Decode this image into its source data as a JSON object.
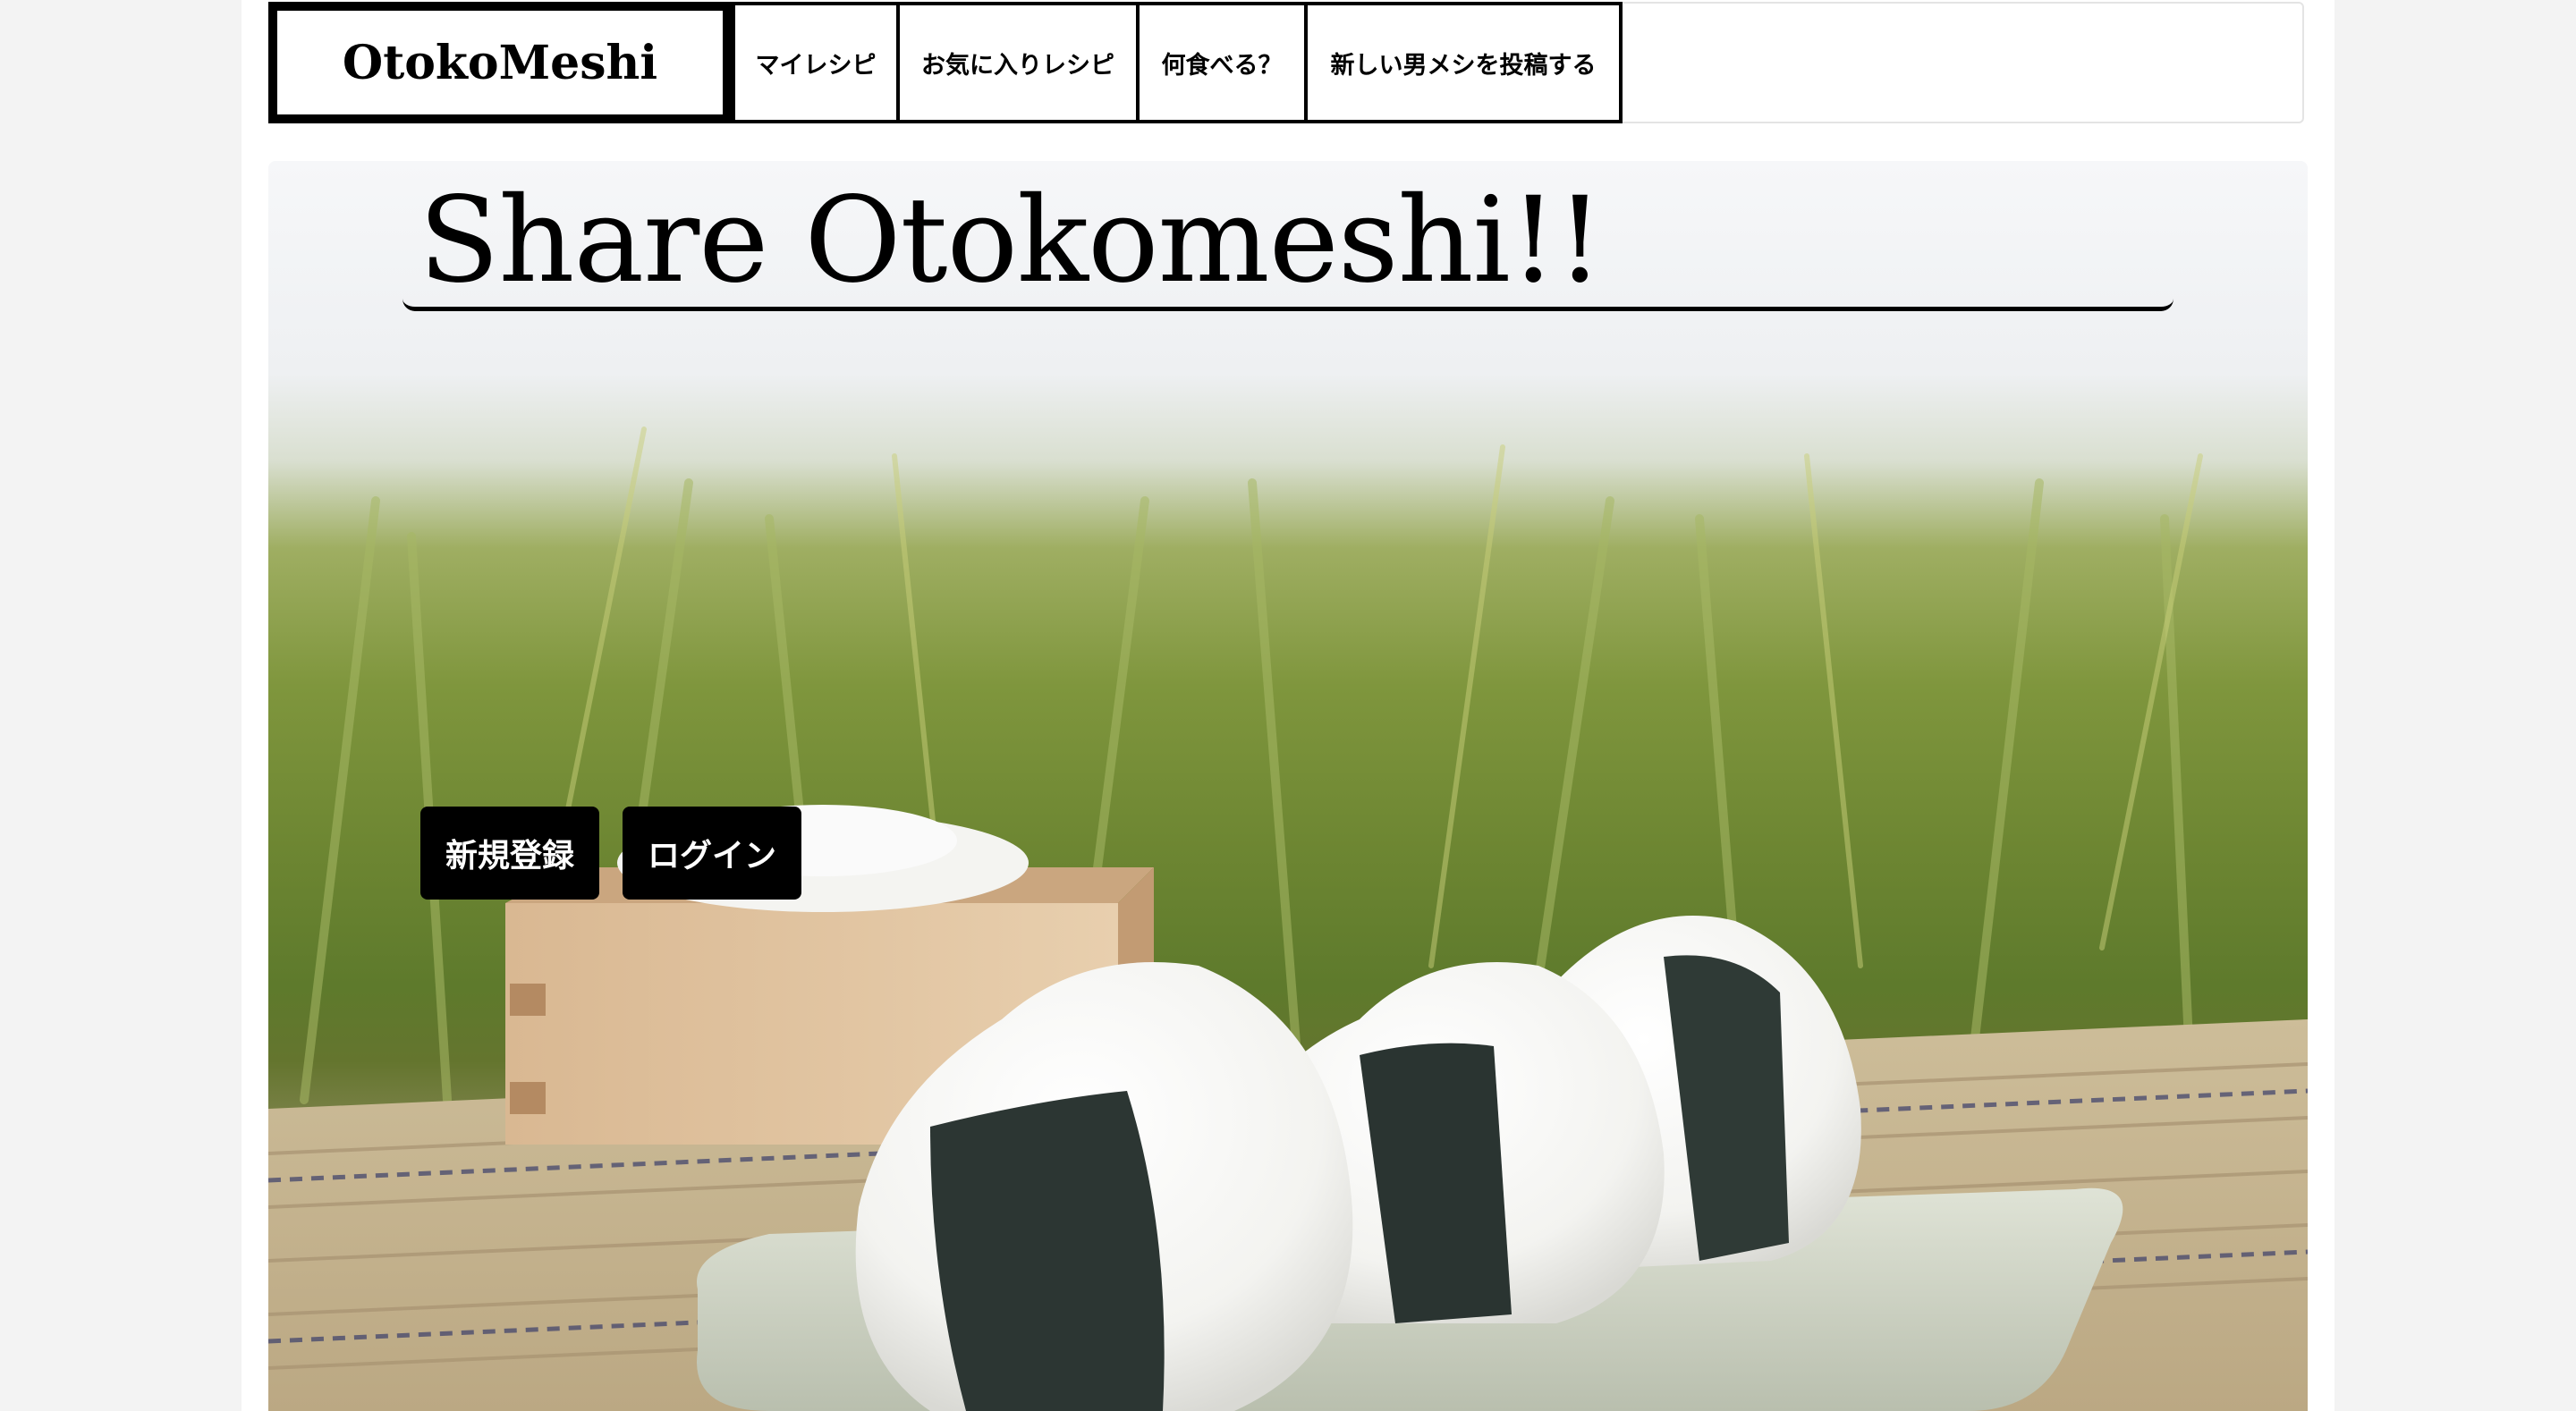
{
  "navbar": {
    "brand": "OtokoMeshi",
    "items": [
      {
        "label": "マイレシピ"
      },
      {
        "label": "お気に入りレシピ"
      },
      {
        "label": "何食べる？"
      },
      {
        "label": "新しい男メシを投稿する"
      }
    ]
  },
  "hero": {
    "title": "Share Otokomeshi!!",
    "image_icon": "onigiri-rice-field-photo",
    "buttons": {
      "signup_label": "新規登録",
      "login_label": "ログイン"
    }
  },
  "colors": {
    "nav_border": "#000000",
    "button_bg": "#000000",
    "button_text": "#ffffff",
    "page_bg": "#f3f3f3"
  }
}
